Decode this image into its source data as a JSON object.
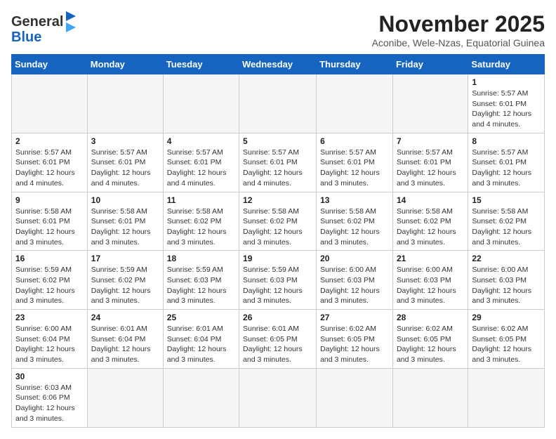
{
  "header": {
    "logo_general": "General",
    "logo_blue": "Blue",
    "month_title": "November 2025",
    "subtitle": "Aconibe, Wele-Nzas, Equatorial Guinea"
  },
  "weekdays": [
    "Sunday",
    "Monday",
    "Tuesday",
    "Wednesday",
    "Thursday",
    "Friday",
    "Saturday"
  ],
  "weeks": [
    [
      {
        "day": "",
        "info": ""
      },
      {
        "day": "",
        "info": ""
      },
      {
        "day": "",
        "info": ""
      },
      {
        "day": "",
        "info": ""
      },
      {
        "day": "",
        "info": ""
      },
      {
        "day": "",
        "info": ""
      },
      {
        "day": "1",
        "info": "Sunrise: 5:57 AM\nSunset: 6:01 PM\nDaylight: 12 hours and 4 minutes."
      }
    ],
    [
      {
        "day": "2",
        "info": "Sunrise: 5:57 AM\nSunset: 6:01 PM\nDaylight: 12 hours and 4 minutes."
      },
      {
        "day": "3",
        "info": "Sunrise: 5:57 AM\nSunset: 6:01 PM\nDaylight: 12 hours and 4 minutes."
      },
      {
        "day": "4",
        "info": "Sunrise: 5:57 AM\nSunset: 6:01 PM\nDaylight: 12 hours and 4 minutes."
      },
      {
        "day": "5",
        "info": "Sunrise: 5:57 AM\nSunset: 6:01 PM\nDaylight: 12 hours and 4 minutes."
      },
      {
        "day": "6",
        "info": "Sunrise: 5:57 AM\nSunset: 6:01 PM\nDaylight: 12 hours and 3 minutes."
      },
      {
        "day": "7",
        "info": "Sunrise: 5:57 AM\nSunset: 6:01 PM\nDaylight: 12 hours and 3 minutes."
      },
      {
        "day": "8",
        "info": "Sunrise: 5:57 AM\nSunset: 6:01 PM\nDaylight: 12 hours and 3 minutes."
      }
    ],
    [
      {
        "day": "9",
        "info": "Sunrise: 5:58 AM\nSunset: 6:01 PM\nDaylight: 12 hours and 3 minutes."
      },
      {
        "day": "10",
        "info": "Sunrise: 5:58 AM\nSunset: 6:01 PM\nDaylight: 12 hours and 3 minutes."
      },
      {
        "day": "11",
        "info": "Sunrise: 5:58 AM\nSunset: 6:02 PM\nDaylight: 12 hours and 3 minutes."
      },
      {
        "day": "12",
        "info": "Sunrise: 5:58 AM\nSunset: 6:02 PM\nDaylight: 12 hours and 3 minutes."
      },
      {
        "day": "13",
        "info": "Sunrise: 5:58 AM\nSunset: 6:02 PM\nDaylight: 12 hours and 3 minutes."
      },
      {
        "day": "14",
        "info": "Sunrise: 5:58 AM\nSunset: 6:02 PM\nDaylight: 12 hours and 3 minutes."
      },
      {
        "day": "15",
        "info": "Sunrise: 5:58 AM\nSunset: 6:02 PM\nDaylight: 12 hours and 3 minutes."
      }
    ],
    [
      {
        "day": "16",
        "info": "Sunrise: 5:59 AM\nSunset: 6:02 PM\nDaylight: 12 hours and 3 minutes."
      },
      {
        "day": "17",
        "info": "Sunrise: 5:59 AM\nSunset: 6:02 PM\nDaylight: 12 hours and 3 minutes."
      },
      {
        "day": "18",
        "info": "Sunrise: 5:59 AM\nSunset: 6:03 PM\nDaylight: 12 hours and 3 minutes."
      },
      {
        "day": "19",
        "info": "Sunrise: 5:59 AM\nSunset: 6:03 PM\nDaylight: 12 hours and 3 minutes."
      },
      {
        "day": "20",
        "info": "Sunrise: 6:00 AM\nSunset: 6:03 PM\nDaylight: 12 hours and 3 minutes."
      },
      {
        "day": "21",
        "info": "Sunrise: 6:00 AM\nSunset: 6:03 PM\nDaylight: 12 hours and 3 minutes."
      },
      {
        "day": "22",
        "info": "Sunrise: 6:00 AM\nSunset: 6:03 PM\nDaylight: 12 hours and 3 minutes."
      }
    ],
    [
      {
        "day": "23",
        "info": "Sunrise: 6:00 AM\nSunset: 6:04 PM\nDaylight: 12 hours and 3 minutes."
      },
      {
        "day": "24",
        "info": "Sunrise: 6:01 AM\nSunset: 6:04 PM\nDaylight: 12 hours and 3 minutes."
      },
      {
        "day": "25",
        "info": "Sunrise: 6:01 AM\nSunset: 6:04 PM\nDaylight: 12 hours and 3 minutes."
      },
      {
        "day": "26",
        "info": "Sunrise: 6:01 AM\nSunset: 6:05 PM\nDaylight: 12 hours and 3 minutes."
      },
      {
        "day": "27",
        "info": "Sunrise: 6:02 AM\nSunset: 6:05 PM\nDaylight: 12 hours and 3 minutes."
      },
      {
        "day": "28",
        "info": "Sunrise: 6:02 AM\nSunset: 6:05 PM\nDaylight: 12 hours and 3 minutes."
      },
      {
        "day": "29",
        "info": "Sunrise: 6:02 AM\nSunset: 6:05 PM\nDaylight: 12 hours and 3 minutes."
      }
    ],
    [
      {
        "day": "30",
        "info": "Sunrise: 6:03 AM\nSunset: 6:06 PM\nDaylight: 12 hours and 3 minutes."
      },
      {
        "day": "",
        "info": ""
      },
      {
        "day": "",
        "info": ""
      },
      {
        "day": "",
        "info": ""
      },
      {
        "day": "",
        "info": ""
      },
      {
        "day": "",
        "info": ""
      },
      {
        "day": "",
        "info": ""
      }
    ]
  ]
}
